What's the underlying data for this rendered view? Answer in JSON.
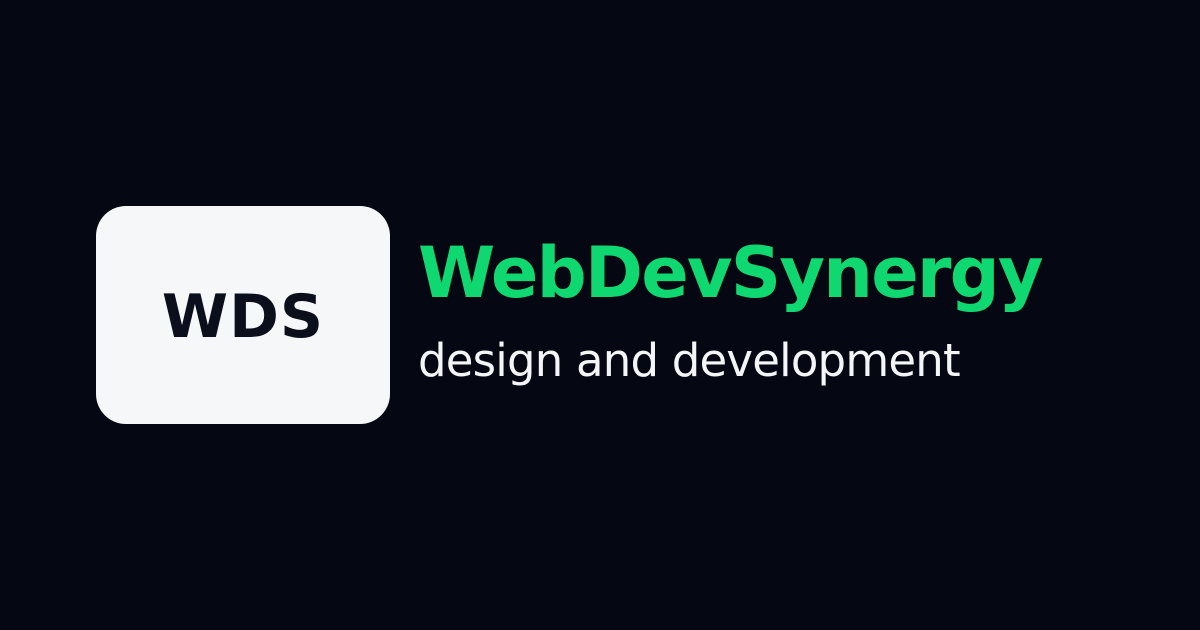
{
  "logo": {
    "text": "WDS",
    "badge_color": "#f6f7f9",
    "text_color": "#0b0f1c"
  },
  "brand": {
    "name": "WebDevSynergy",
    "tagline": "design and development",
    "name_color": "#10d871",
    "tagline_color": "#f4f5f7"
  },
  "background_color": "#050813"
}
